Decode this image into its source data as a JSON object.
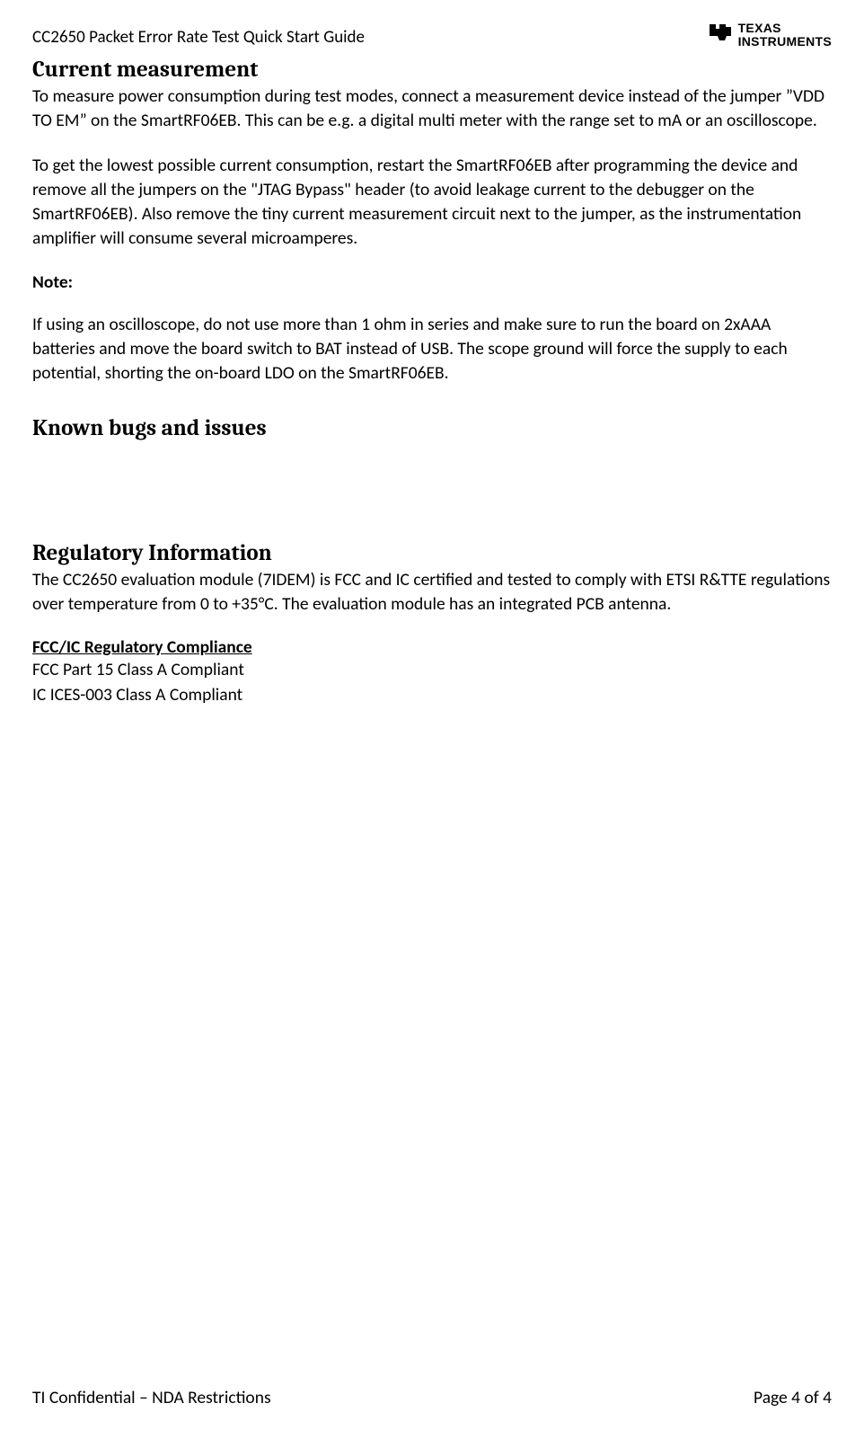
{
  "header": {
    "doc_title": "CC2650 Packet Error Rate Test Quick Start Guide",
    "logo_line1": "TEXAS",
    "logo_line2": "INSTRUMENTS"
  },
  "sections": {
    "current_measurement": {
      "heading": "Current measurement",
      "p1": "To measure power consumption during test modes, connect a measurement device instead of the jumper  ”VDD TO EM” on the SmartRF06EB. This can be e.g. a digital multi meter with the range set to mA or an oscilloscope.",
      "p2": "To get the lowest possible current consumption, restart the SmartRF06EB after programming the device and remove all the jumpers on the \"JTAG Bypass\" header (to avoid leakage current to the debugger on the SmartRF06EB). Also remove the tiny current measurement circuit next to the jumper, as the instrumentation amplifier will consume several microamperes.",
      "note_label": "Note:",
      "note_body": "If using an oscilloscope, do not use more than 1 ohm in series and make sure to run the board on 2xAAA batteries and move the board switch to BAT instead of USB.  The scope ground will force the supply to each potential, shorting the on-board LDO on the SmartRF06EB."
    },
    "known_bugs": {
      "heading": "Known bugs and issues"
    },
    "regulatory": {
      "heading": "Regulatory Information",
      "p1": "The CC2650 evaluation module (7IDEM) is FCC and IC certified and tested to comply with ETSI R&TTE regulations over temperature from 0 to +35°C. The evaluation module has an integrated PCB antenna.",
      "sub_heading": "FCC/IC Regulatory Compliance",
      "line1": "FCC Part 15 Class A Compliant",
      "line2": "IC ICES-003 Class A Compliant"
    }
  },
  "footer": {
    "left": "TI Confidential – NDA Restrictions",
    "right": "Page 4 of 4"
  }
}
